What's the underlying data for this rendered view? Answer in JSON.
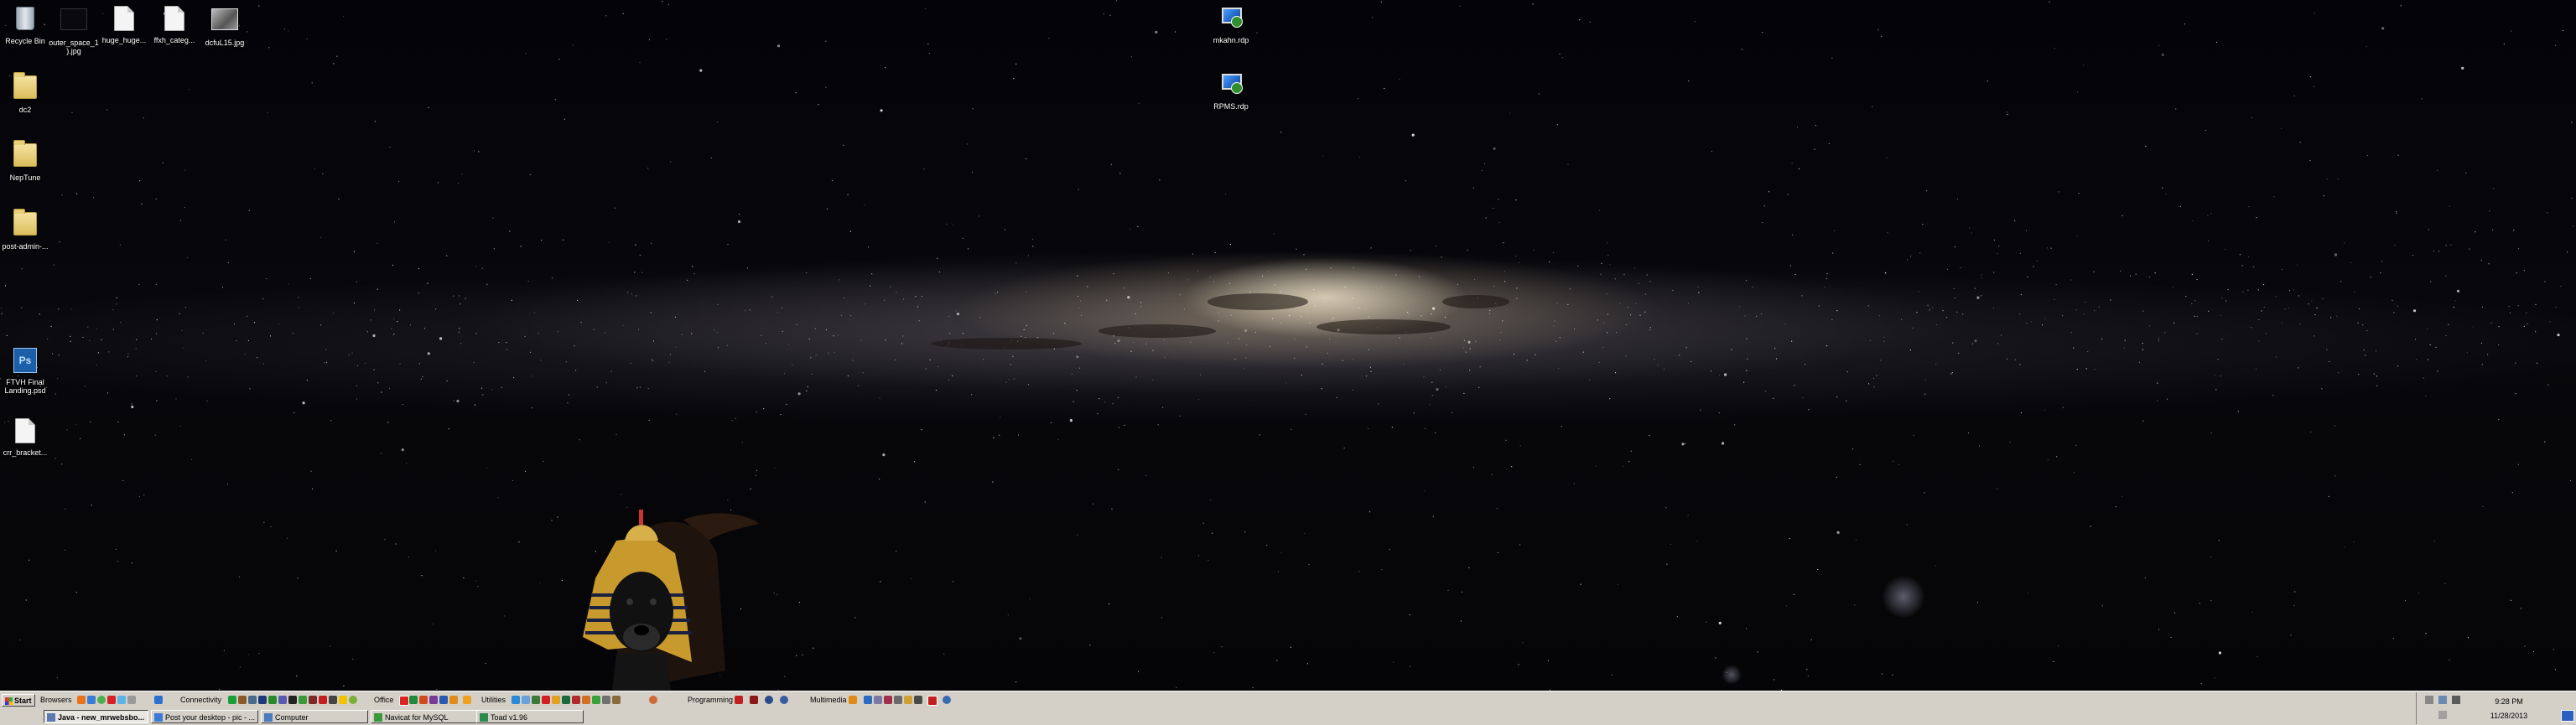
{
  "desktop": {
    "icons": [
      {
        "label": "Recycle Bin",
        "type": "bin"
      },
      {
        "label": "outer_space_1).jpg",
        "type": "img-dark"
      },
      {
        "label": "huge_huge...",
        "type": "doc"
      },
      {
        "label": "ffxh_categ...",
        "type": "doc"
      },
      {
        "label": "dcfuL15.jpg",
        "type": "img"
      },
      {
        "label": "dc2",
        "type": "folder"
      },
      {
        "label": "NepTune",
        "type": "folder"
      },
      {
        "label": "post-admin-...",
        "type": "folder"
      },
      {
        "label": "FTVH Final Landing.psd",
        "type": "psd"
      },
      {
        "label": "crr_bracket...",
        "type": "doc"
      },
      {
        "label": "mkahn.rdp",
        "type": "rdp"
      },
      {
        "label": "RPMS.rdp",
        "type": "rdp"
      }
    ]
  },
  "taskbar": {
    "start_label": "Start",
    "groups": {
      "browsers": "Browsers",
      "connectivity": "Connectivity",
      "office": "Office",
      "utilities": "Utilities",
      "programming": "Programming",
      "multimedia": "Multimedia"
    },
    "tasks": [
      {
        "label": "Java - new_mrwebsbo..."
      },
      {
        "label": "Post your desktop - pic - ..."
      },
      {
        "label": "Computer"
      },
      {
        "label": "Navicat for MySQL"
      },
      {
        "label": "Toad v1.96"
      }
    ],
    "clock": {
      "time": "9:28 PM",
      "date": "11/28/2013"
    }
  },
  "colors": {
    "taskbar": "#d4d0c8",
    "sky": "#050507",
    "galaxy_core": "#e8dec4"
  },
  "icons": {
    "start": "windows-flag-icon",
    "show_desktop": "show-desktop-icon"
  }
}
